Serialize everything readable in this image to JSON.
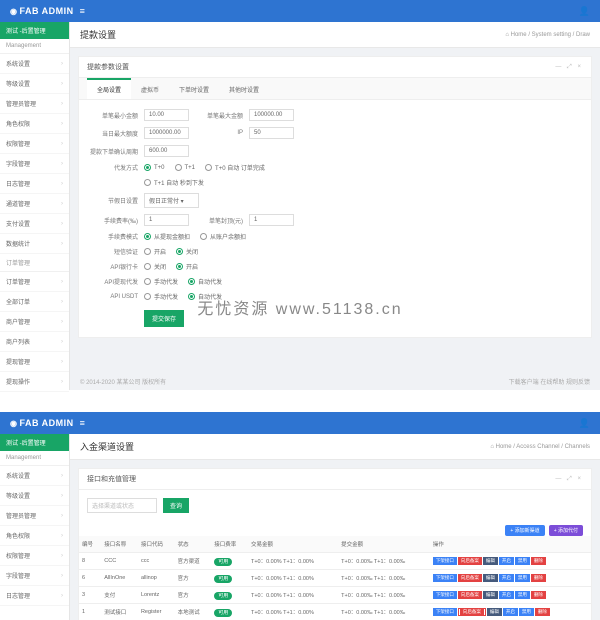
{
  "brand": "FAB ADMIN",
  "watermark": "无忧资源  www.51138.cn",
  "sidebar": {
    "head": "测试 -后置管理",
    "group": "Management",
    "items": [
      "系统设置",
      "等级设置",
      "管理员管理",
      "角色权限",
      "权限管理",
      "字段管理",
      "日志管理",
      "通道管理",
      "支付设置",
      "数据统计"
    ],
    "group2": "订单管理",
    "items2": [
      "订单管理",
      "全部订单",
      "商户管理",
      "商户列表",
      "提现管理",
      "提现操作"
    ]
  },
  "shot1": {
    "title": "提款设置",
    "crumb": "Home / System setting / Draw",
    "panelTitle": "提款参数设置",
    "tabs": [
      "全局设置",
      "虚拟币",
      "下单时设置",
      "其他时设置"
    ],
    "f": {
      "lbl_min": "单笔最小金额",
      "v_min": "10.00",
      "lbl_max": "单笔最大金额",
      "v_max": "100000.00",
      "lbl_daymax": "当日最大额度",
      "v_daymax": "1000000.00",
      "lbl_ip": "IP",
      "v_ip": "50",
      "lbl_hours": "提款下单确认周期",
      "v_hours": "600.00",
      "lbl_mode": "代发方式",
      "r_t0": "T+0",
      "r_t1": "T+1",
      "r_auto": "T+0 自动 订单完成",
      "r_t1b": "T+1 自动 秒到下发",
      "lbl_holiday": "节假日设置",
      "sel_holiday": "假日正常付",
      "lbl_fee": "手续费率(‰)",
      "v_fee": "1",
      "lbl_cap": "单笔封顶(元)",
      "v_cap": "1",
      "lbl_feemode": "手续费模式",
      "r_inner": "从提现金额扣",
      "r_outer": "从账户余额扣",
      "lbl_sms": "短信验证",
      "r_y": "开启",
      "r_n": "关闭",
      "lbl_bank": "API银行卡",
      "r_close": "关闭",
      "r_open": "开启",
      "lbl_api": "API提现代发",
      "r_a1": "手动代发",
      "r_a2": "自动代发",
      "lbl_usdt": "API USDT",
      "r_u1": "手动代发",
      "r_u2": "自动代发",
      "submit": "提交保存"
    },
    "copyright": "© 2014-2020 某某公司 版权所有",
    "footRight": "下载客户端 在线帮助  规则反馈"
  },
  "shot2": {
    "title": "入金渠道设置",
    "crumb": "Home / Access Channel / Channels",
    "panelTitle": "接口和充值管理",
    "searchPh": "选择渠道或状态",
    "searchBtn": "查询",
    "btnAdd": "+ 添加新渠道",
    "btnNew": "+ 添加代付",
    "th": [
      "编号",
      "接口名称",
      "接口代码",
      "状态",
      "接口费率",
      "交易金额",
      "提交金额",
      "操作"
    ],
    "rows": [
      {
        "id": "8",
        "name": "CCC",
        "code": "ccc",
        "ch": "官方渠道",
        "st": "可用",
        "tx": "T+0：0.00%  T+1：0.00%",
        "sub": "T+0：0.00‰  T+1：0.00‰"
      },
      {
        "id": "6",
        "name": "AllInOne",
        "code": "allinop",
        "ch": "官方",
        "st": "可用",
        "tx": "T+0：0.00%  T+1：0.00%",
        "sub": "T+0：0.00‰  T+1：0.00‰"
      },
      {
        "id": "3",
        "name": "支付",
        "code": "Lorentz",
        "ch": "官方",
        "st": "可用",
        "tx": "T+0：0.00%  T+1：0.00%",
        "sub": "T+0：0.00‰  T+1：0.00‰"
      },
      {
        "id": "1",
        "name": "测试接口",
        "code": "Register",
        "ch": "本地测试",
        "st": "可用",
        "tx": "T+0：0.00%  T+1：0.00%",
        "sub": "T+0：0.00‰  T+1：0.00‰"
      }
    ],
    "ops": [
      "下架接口",
      "向后备案",
      "编辑",
      "开启",
      "禁用",
      "删除"
    ]
  }
}
